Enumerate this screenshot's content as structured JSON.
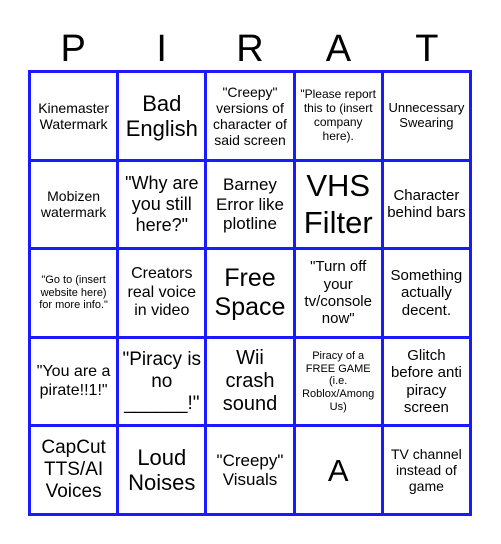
{
  "title_letters": [
    "P",
    "I",
    "R",
    "A",
    "T"
  ],
  "colors": {
    "grid_border": "#1a1aff",
    "cell_background": "#ffffff",
    "text": "#000000"
  },
  "board": {
    "rows": [
      [
        "Kinemaster Watermark",
        "Bad English",
        "\"Creepy\" versions of character of said screen",
        "\"Please report this to (insert company here).",
        "Unnecessary Swearing"
      ],
      [
        "Mobizen watermark",
        "\"Why are you still here?\"",
        "Barney Error like plotline",
        "VHS Filter",
        "Character behind bars"
      ],
      [
        "\"Go to (insert website here) for more info.\"",
        "Creators real voice in video",
        "Free Space",
        "\"Turn off your tv/console now\"",
        "Something actually decent."
      ],
      [
        "\"You are a pirate!!1!\"",
        "\"Piracy is no ______!\"",
        "Wii crash sound",
        "Piracy of a FREE GAME (i.e. Roblox/Among Us)",
        "Glitch before anti piracy screen"
      ],
      [
        "CapCut TTS/AI Voices",
        "Loud Noises",
        "\"Creepy\" Visuals",
        "A",
        "TV channel instead of game"
      ]
    ]
  }
}
